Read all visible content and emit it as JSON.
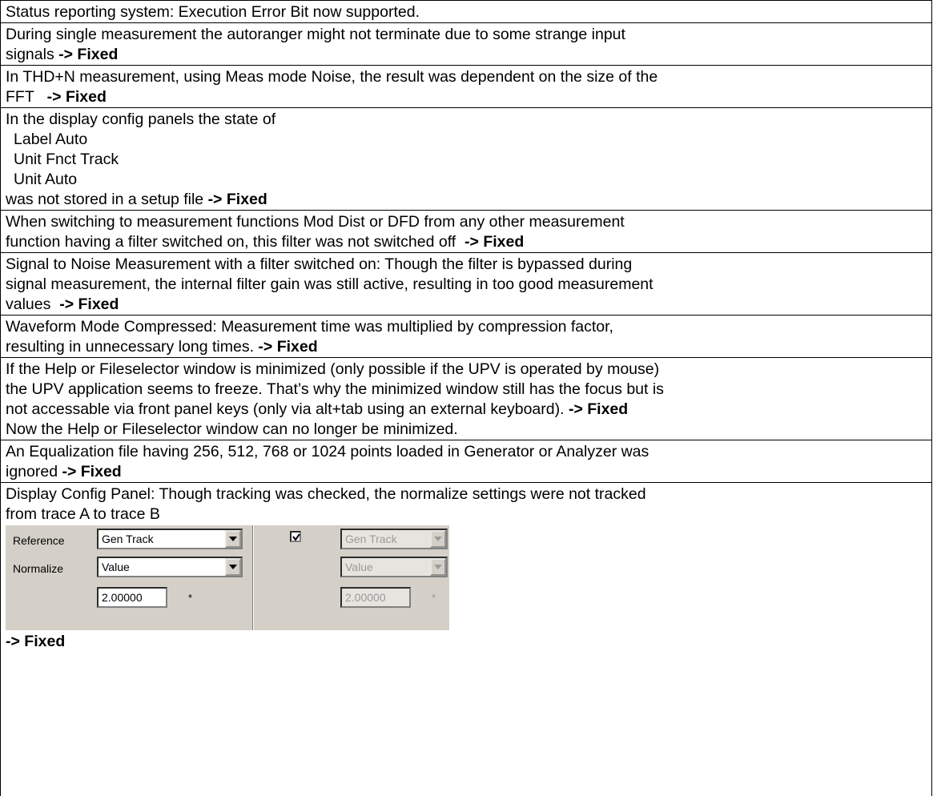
{
  "rows": [
    {
      "lines": [
        {
          "text": "Status reporting system: Execution Error Bit now supported.",
          "fixed": ""
        }
      ]
    },
    {
      "lines": [
        {
          "text": "During single measurement the autoranger might not terminate due to some strange input",
          "fixed": ""
        },
        {
          "text": "signals ",
          "fixed": "-> Fixed"
        }
      ]
    },
    {
      "lines": [
        {
          "text": "In THD+N measurement, using Meas mode Noise, the result was dependent on the size of the",
          "fixed": ""
        },
        {
          "text": "FFT   ",
          "fixed": "-> Fixed"
        }
      ]
    },
    {
      "lines": [
        {
          "text": "In the display config panels the state of",
          "fixed": ""
        },
        {
          "text": "Label Auto",
          "fixed": "",
          "indent": true
        },
        {
          "text": "Unit Fnct Track",
          "fixed": "",
          "indent": true
        },
        {
          "text": "Unit Auto",
          "fixed": "",
          "indent": true
        },
        {
          "text": "was not stored in a setup file ",
          "fixed": "-> Fixed"
        }
      ]
    },
    {
      "lines": [
        {
          "text": "When switching to measurement functions Mod Dist or DFD from any other measurement",
          "fixed": ""
        },
        {
          "text": "function having a filter switched on, this filter was not switched off  ",
          "fixed": "-> Fixed"
        }
      ]
    },
    {
      "lines": [
        {
          "text": "Signal to Noise Measurement with a filter switched on: Though the filter is bypassed during",
          "fixed": ""
        },
        {
          "text": "signal measurement, the internal filter gain was still active, resulting in too good measurement",
          "fixed": ""
        },
        {
          "text": "values  ",
          "fixed": "-> Fixed"
        }
      ]
    },
    {
      "lines": [
        {
          "text": "Waveform Mode Compressed: Measurement time was multiplied by compression factor,",
          "fixed": ""
        },
        {
          "text": "resulting in unnecessary long times. ",
          "fixed": "-> Fixed"
        }
      ]
    },
    {
      "lines": [
        {
          "text": "If the Help or Fileselector window is minimized (only possible if the UPV is operated by mouse)",
          "fixed": ""
        },
        {
          "text": "the UPV application seems to freeze. That’s why the minimized window still has the focus but is",
          "fixed": ""
        },
        {
          "text": "not accessable via front panel keys (only via alt+tab using an external keyboard). ",
          "fixed": "-> Fixed"
        },
        {
          "text": "Now the Help or Fileselector window can no longer be minimized.",
          "fixed": ""
        }
      ]
    },
    {
      "lines": [
        {
          "text": "An Equalization file having 256, 512, 768 or 1024 points loaded in Generator or Analyzer was",
          "fixed": ""
        },
        {
          "text": "ignored ",
          "fixed": "-> Fixed"
        }
      ]
    }
  ],
  "last_row": {
    "line1": "Display Config Panel: Though tracking was checked, the normalize settings were not tracked",
    "line2": "from trace A to trace B",
    "fixed": "-> Fixed",
    "panel": {
      "reference_label": "Reference",
      "normalize_label": "Normalize",
      "reference_value_a": "Gen Track",
      "normalize_value_a": "Value",
      "number_value_a": "2.00000",
      "unit_a": "*",
      "track_checked": true,
      "reference_value_b": "Gen Track",
      "normalize_value_b": "Value",
      "number_value_b": "2.00000",
      "unit_b": "*"
    }
  }
}
